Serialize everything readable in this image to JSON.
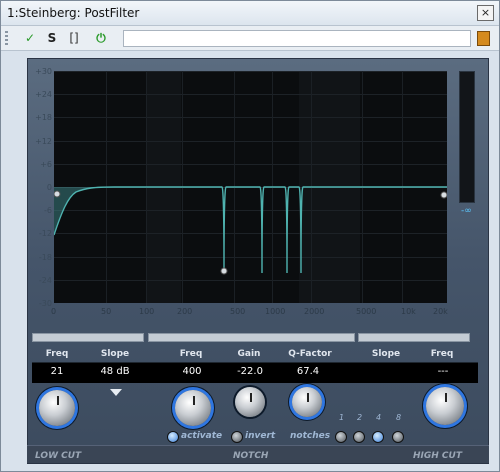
{
  "window": {
    "title": "1:Steinberg: PostFilter",
    "close_glyph": "×"
  },
  "toolbar": {
    "check_icon": "checkmark-icon",
    "check_glyph": "✓",
    "s_label": "S",
    "bracket_label": "[]",
    "power_glyph": "⏻",
    "preset_field_value": ""
  },
  "display": {
    "y_ticks": [
      "+30",
      "+24",
      "+18",
      "+12",
      "+6",
      "0",
      "-6",
      "-12",
      "-18",
      "-24",
      "-30"
    ],
    "x_ticks": [
      "0",
      "50",
      "100",
      "200",
      "500",
      "1000",
      "2000",
      "5000",
      "10k",
      "20k"
    ],
    "meter_value": "-∞",
    "colors": {
      "curve": "#4fb3b0",
      "fill": "#3a7d7f",
      "accent": "#2f76e0"
    }
  },
  "lowcut": {
    "header_freq": "Freq",
    "header_slope": "Slope",
    "freq_value": "21",
    "slope_value": "48 dB",
    "footer": "LOW CUT"
  },
  "notch": {
    "header_freq": "Freq",
    "header_gain": "Gain",
    "header_q": "Q-Factor",
    "freq_value": "400",
    "gain_value": "-22.0",
    "q_value": "67.4",
    "activate_label": "activate",
    "invert_label": "invert",
    "notches_label": "notches",
    "notch_options": [
      "1",
      "2",
      "4",
      "8"
    ],
    "footer": "NOTCH"
  },
  "highcut": {
    "header_slope": "Slope",
    "header_freq": "Freq",
    "freq_value": "---",
    "footer": "HIGH CUT"
  }
}
